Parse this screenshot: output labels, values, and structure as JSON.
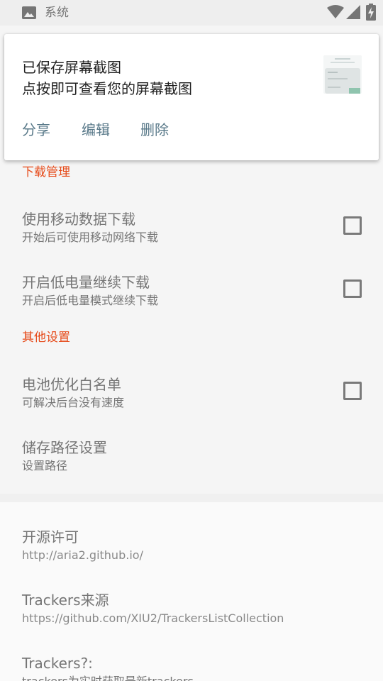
{
  "status_bar": {
    "app_name": "系统",
    "icons": [
      "image-icon",
      "wifi-icon",
      "cell-signal-icon",
      "battery-charging-icon"
    ]
  },
  "notification": {
    "title": "已保存屏幕截图",
    "text": "点按即可查看您的屏幕截图",
    "actions": {
      "share": "分享",
      "edit": "编辑",
      "delete": "删除"
    },
    "accent_color": "#5a7a8a"
  },
  "settings": {
    "download_section": {
      "header": "下载管理",
      "items": [
        {
          "title": "使用移动数据下载",
          "summary": "开始后可使用移动网络下载",
          "checked": false
        },
        {
          "title": "开启低电量继续下载",
          "summary": "开启后低电量模式继续下载",
          "checked": false
        }
      ]
    },
    "other_section": {
      "header": "其他设置",
      "items": [
        {
          "title": "电池优化白名单",
          "summary": "可解决后台没有速度",
          "checked": false
        },
        {
          "title": "储存路径设置",
          "summary": "设置路径"
        }
      ]
    },
    "about_section": {
      "items": [
        {
          "title": "开源许可",
          "summary": "http://aria2.github.io/"
        },
        {
          "title": "Trackers来源",
          "summary": "https://github.com/XIU2/TrackersListCollection"
        },
        {
          "title": "Trackers?:",
          "summary": "trackers为实时获取最新trackers"
        }
      ]
    },
    "header_color": "#e64a19"
  }
}
